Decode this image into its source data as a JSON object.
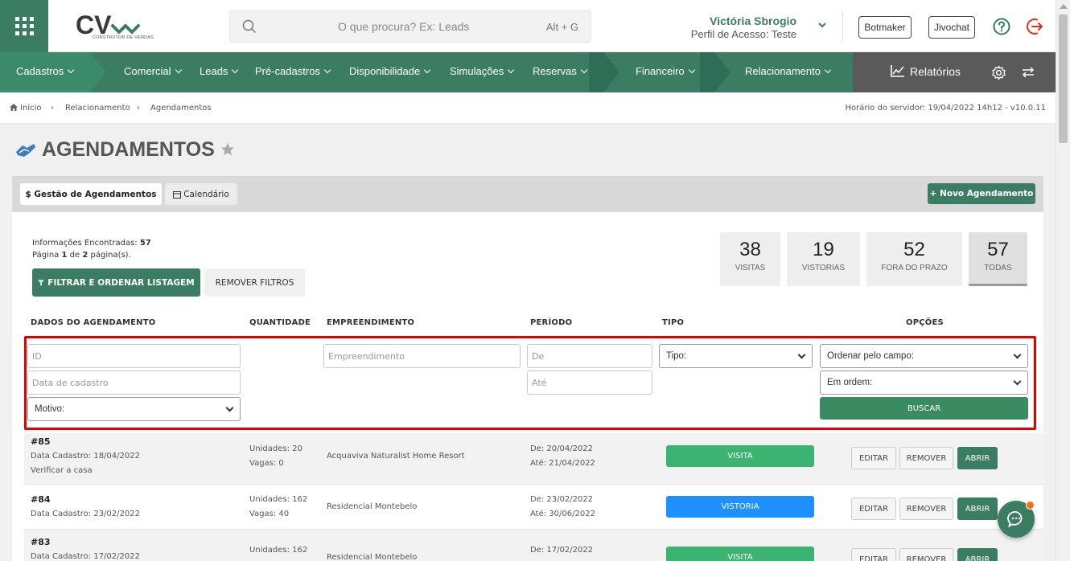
{
  "header": {
    "logo_text": "CV",
    "logo_subtitle": "CONSTRUTOR DE VENDAS",
    "search_placeholder": "O que procura? Ex: Leads",
    "search_shortcut": "Alt + G",
    "user_name": "Victória Sbrogio",
    "user_profile": "Perfil de Acesso: Teste",
    "btn_botmaker": "Botmaker",
    "btn_jivochat": "Jivochat",
    "icons": [
      "apps-grid-icon",
      "search-icon",
      "chevron-down-icon",
      "help-icon",
      "logout-icon"
    ]
  },
  "nav": {
    "items": [
      "Cadastros",
      "Comercial",
      "Leads",
      "Pré-cadastros",
      "Disponibilidade",
      "Simulações",
      "Reservas",
      "Financeiro",
      "Relacionamento"
    ],
    "reports": "Relatórios",
    "icons": [
      "chart-line-icon",
      "gear-icon",
      "swap-arrows-icon"
    ]
  },
  "breadcrumb": {
    "items": [
      "Início",
      "Relacionamento",
      "Agendamentos"
    ],
    "server_time": "Horário do servidor: 19/04/2022 14h12 - v10.0.11"
  },
  "page": {
    "title": "AGENDAMENTOS"
  },
  "tabs": {
    "gestao": "$ Gestão de Agendamentos",
    "calendario": "Calendário",
    "novo": "+ Novo Agendamento"
  },
  "info": {
    "found_label": "Informações Encontradas:",
    "found_value": "57",
    "page_label_a": "Página",
    "page_current": "1",
    "page_label_b": "de",
    "page_total": "2",
    "page_label_c": "página(s)."
  },
  "actions": {
    "filter": "FILTRAR E ORDENAR LISTAGEM",
    "remove_filters": "REMOVER FILTROS"
  },
  "stats": [
    {
      "value": "38",
      "label": "VISITAS"
    },
    {
      "value": "19",
      "label": "VISTORIAS"
    },
    {
      "value": "52",
      "label": "FORA DO PRAZO"
    },
    {
      "value": "57",
      "label": "TODAS"
    }
  ],
  "columns": [
    "DADOS DO AGENDAMENTO",
    "QUANTIDADE",
    "EMPREENDIMENTO",
    "PERÍODO",
    "TIPO",
    "OPÇÕES"
  ],
  "filters": {
    "id": "ID",
    "data_cadastro": "Data de cadastro",
    "motivo": "Motivo:",
    "empreendimento": "Empreendimento",
    "de": "De",
    "ate": "Até",
    "tipo": "Tipo:",
    "ordenar": "Ordenar pelo campo:",
    "ordem": "Em ordem:",
    "buscar": "BUSCAR"
  },
  "rows": [
    {
      "id": "#85",
      "data": "Data Cadastro: 18/04/2022",
      "motivo": "Verificar a casa",
      "unidades": "Unidades: 20",
      "vagas": "Vagas: 0",
      "empreendimento": "Acquaviva Naturalist Home Resort",
      "de": "De: 20/04/2022",
      "ate": "Até: 21/04/2022",
      "tipo": "VISITA",
      "tipo_color": "#3cb371"
    },
    {
      "id": "#84",
      "data": "Data Cadastro: 23/02/2022",
      "motivo": "",
      "unidades": "Unidades: 162",
      "vagas": "Vagas: 40",
      "empreendimento": "Residencial Montebelo",
      "de": "De: 23/02/2022",
      "ate": "Até: 30/06/2022",
      "tipo": "VISTORIA",
      "tipo_color": "#1e90ff"
    },
    {
      "id": "#83",
      "data": "Data Cadastro: 17/02/2022",
      "motivo": "",
      "unidades": "Unidades: 162",
      "vagas": "",
      "empreendimento": "Residencial Montebelo",
      "de": "De: 17/02/2022",
      "ate": "",
      "tipo": "VISITA",
      "tipo_color": "#3cb371"
    }
  ],
  "row_buttons": {
    "edit": "EDITAR",
    "remove": "REMOVER",
    "open": "ABRIR"
  },
  "colors": {
    "brand_green": "#3b7d63",
    "highlight_red": "#e00000",
    "visita": "#3cb371",
    "vistoria": "#1e90ff"
  }
}
